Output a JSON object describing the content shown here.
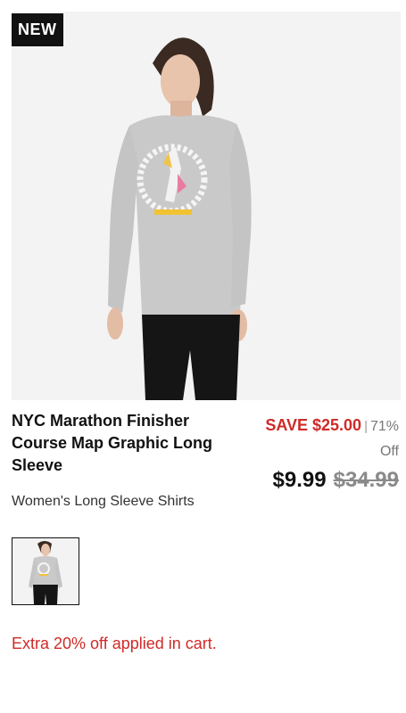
{
  "badge": {
    "label": "NEW"
  },
  "product": {
    "title": "NYC Marathon Finisher Course Map Graphic Long Sleeve",
    "category": "Women's Long Sleeve Shirts",
    "image_icon": "product-photo",
    "thumbnail_icon": "product-thumbnail"
  },
  "pricing": {
    "save_label": "SAVE $25.00",
    "separator": "|",
    "discount_pct": "71%",
    "off_label": "Off",
    "price_now": "$9.99",
    "price_was": "$34.99"
  },
  "promo": {
    "text": "Extra 20% off applied in cart."
  },
  "colors": {
    "sale_red": "#cf2a27",
    "badge_bg": "#111111",
    "image_bg": "#f3f3f3"
  }
}
